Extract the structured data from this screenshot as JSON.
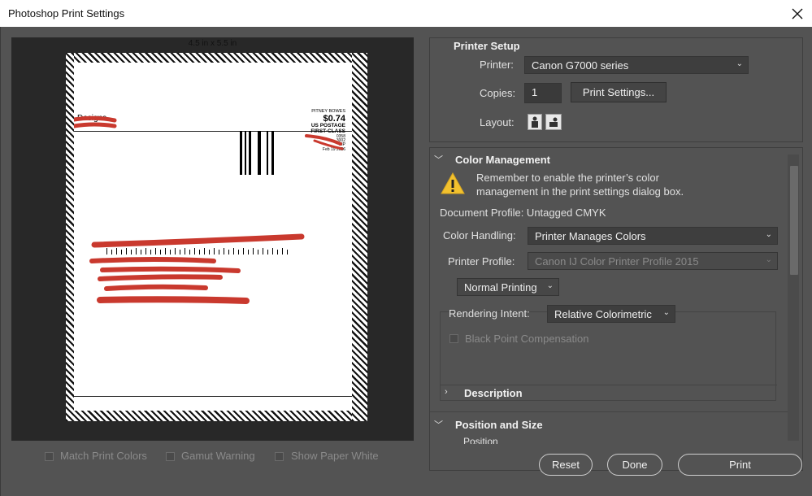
{
  "window": {
    "title": "Photoshop Print Settings"
  },
  "preview": {
    "paper_size": "4.5 in x 5.5 in",
    "designs_text": "Designs",
    "postage": {
      "line1": "PITNEY BOWES",
      "amount": "$0.74",
      "line3": "US POSTAGE",
      "line4": "FIRST-CLASS",
      "line5": "0358",
      "line6": "3002",
      "line7": "ZIP",
      "date": "Feb 19 2026"
    }
  },
  "bottom_checks": [
    {
      "label": "Match Print Colors"
    },
    {
      "label": "Gamut Warning"
    },
    {
      "label": "Show Paper White"
    }
  ],
  "printer_setup": {
    "title": "Printer Setup",
    "printer_label": "Printer:",
    "printer_value": "Canon G7000 series",
    "copies_label": "Copies:",
    "copies_value": "1",
    "print_settings_button": "Print Settings...",
    "layout_label": "Layout:"
  },
  "color_management": {
    "title": "Color Management",
    "warning": "Remember to enable the printer’s color management in the print settings dialog box.",
    "document_profile": "Document Profile: Untagged CMYK",
    "color_handling_label": "Color Handling:",
    "color_handling_value": "Printer Manages Colors",
    "printer_profile_label": "Printer Profile:",
    "printer_profile_value": "Canon IJ Color Printer Profile 2015",
    "printing_mode": "Normal Printing",
    "rendering_intent_label": "Rendering Intent:",
    "rendering_intent_value": "Relative Colorimetric",
    "bpc_label": "Black Point Compensation"
  },
  "description": {
    "title": "Description"
  },
  "position_size": {
    "title": "Position and Size",
    "sub_label": "Position"
  },
  "buttons": {
    "reset": "Reset",
    "done": "Done",
    "print": "Print"
  },
  "colors": {
    "redaction": "#c9392e",
    "warning_yellow": "#f2c12e",
    "panel": "#535353",
    "preview_bg": "#282828"
  },
  "icons": {
    "close": "close-icon",
    "warning": "warning-icon",
    "layout_portrait": "portrait-layout-icon",
    "layout_landscape": "landscape-layout-icon"
  }
}
